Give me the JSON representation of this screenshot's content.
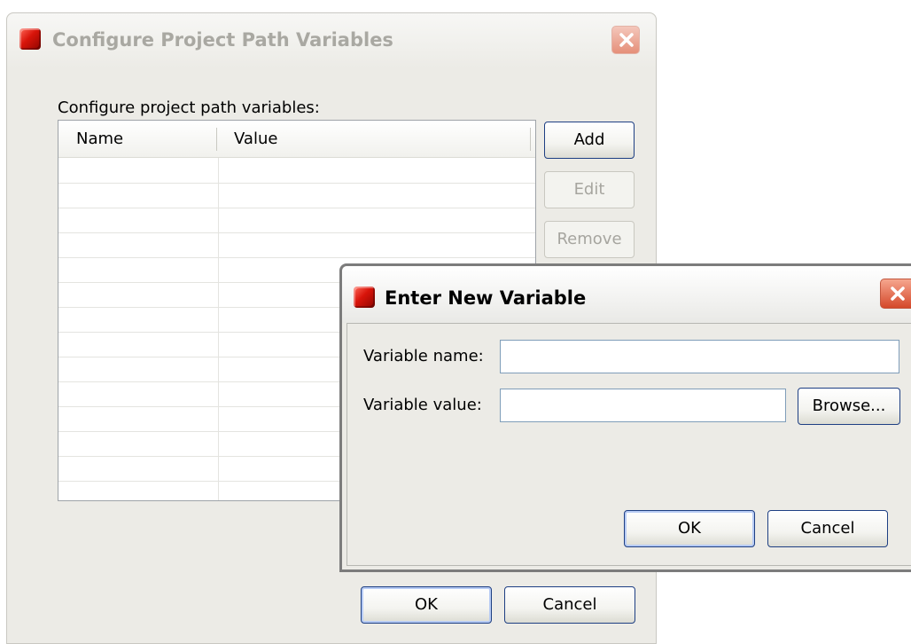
{
  "background_dialog": {
    "title": "Configure Project Path Variables",
    "label": "Configure project path variables:",
    "table": {
      "columns": [
        "Name",
        "Value"
      ],
      "rows": []
    },
    "buttons": {
      "add": "Add",
      "edit": "Edit",
      "remove": "Remove",
      "ok": "OK",
      "cancel": "Cancel"
    }
  },
  "foreground_dialog": {
    "title": "Enter New Variable",
    "variable_name_label": "Variable name:",
    "variable_name_value": "",
    "variable_value_label": "Variable value:",
    "variable_value_value": "",
    "browse": "Browse...",
    "ok": "OK",
    "cancel": "Cancel"
  },
  "icons": {
    "app": "red-cube-icon",
    "close": "close-icon"
  },
  "colors": {
    "dialog_bg": "#ecebe6",
    "button_border": "#1e3f83",
    "close_button": "#d4482a",
    "disabled_text": "#a6a59f"
  }
}
